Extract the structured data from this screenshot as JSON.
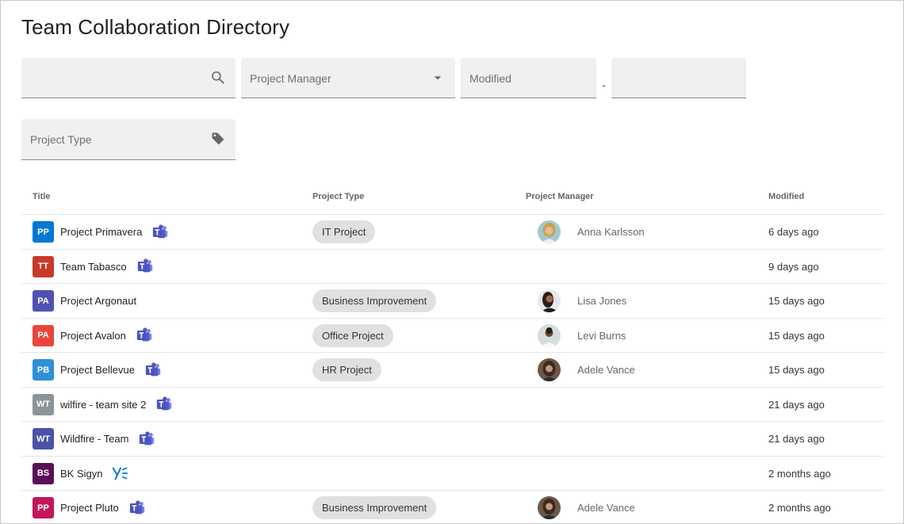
{
  "page": {
    "title": "Team Collaboration Directory"
  },
  "filters": {
    "search": {
      "placeholder": ""
    },
    "project_manager": {
      "label": "Project Manager"
    },
    "modified_from": {
      "label": "Modified"
    },
    "modified_to": {
      "label": ""
    },
    "range_separator": "-",
    "project_type": {
      "label": "Project Type"
    }
  },
  "table": {
    "columns": {
      "title": "Title",
      "project_type": "Project Type",
      "project_manager": "Project Manager",
      "modified": "Modified"
    },
    "rows": [
      {
        "initials": "PP",
        "color": "#0078d4",
        "name": "Project Primavera",
        "app": "teams",
        "type": "IT Project",
        "manager": "Anna Karlsson",
        "avatar": "anna",
        "modified": "6 days ago"
      },
      {
        "initials": "TT",
        "color": "#c8392b",
        "name": "Team Tabasco",
        "app": "teams",
        "type": "",
        "manager": "",
        "avatar": "",
        "modified": "9 days ago"
      },
      {
        "initials": "PA",
        "color": "#4f52b2",
        "name": "Project Argonaut",
        "app": "",
        "type": "Business Improvement",
        "manager": "Lisa Jones",
        "avatar": "lisa",
        "modified": "15 days ago"
      },
      {
        "initials": "PA",
        "color": "#e9453c",
        "name": "Project Avalon",
        "app": "teams",
        "type": "Office Project",
        "manager": "Levi Burns",
        "avatar": "levi",
        "modified": "15 days ago"
      },
      {
        "initials": "PB",
        "color": "#2e90d6",
        "name": "Project Bellevue",
        "app": "teams",
        "type": "HR Project",
        "manager": "Adele Vance",
        "avatar": "adele",
        "modified": "15 days ago"
      },
      {
        "initials": "WT",
        "color": "#8a9597",
        "name": "wilfire - team site 2",
        "app": "teams",
        "type": "",
        "manager": "",
        "avatar": "",
        "modified": "21 days ago"
      },
      {
        "initials": "WT",
        "color": "#4b52a8",
        "name": "Wildfire - Team",
        "app": "teams",
        "type": "",
        "manager": "",
        "avatar": "",
        "modified": "21 days ago"
      },
      {
        "initials": "BS",
        "color": "#5b0f56",
        "name": "BK Sigyn",
        "app": "yammer",
        "type": "",
        "manager": "",
        "avatar": "",
        "modified": "2 months ago"
      },
      {
        "initials": "PP",
        "color": "#c2185b",
        "name": "Project Pluto",
        "app": "teams",
        "type": "Business Improvement",
        "manager": "Adele Vance",
        "avatar": "adele",
        "modified": "2 months ago"
      }
    ]
  },
  "icons": {
    "search": "search-icon",
    "dropdown": "caret-down-icon",
    "tag": "tag-icon",
    "teams": "teams-icon",
    "yammer": "yammer-icon"
  },
  "colors": {
    "field_bg": "#f0f0f0",
    "chip_bg": "#e0e0e0",
    "teams_purple": "#5059c9",
    "yammer_blue": "#0078d4"
  }
}
